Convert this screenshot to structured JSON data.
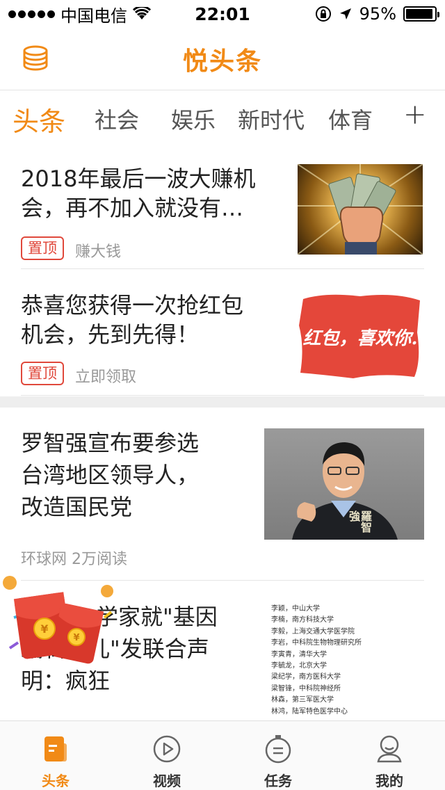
{
  "status_bar": {
    "carrier": "中国电信",
    "time": "22:01",
    "battery_percent": "95%",
    "battery_level": 0.95
  },
  "header": {
    "title": "悦头条"
  },
  "tabs": {
    "items": [
      "头条",
      "社会",
      "娱乐",
      "新时代",
      "体育"
    ],
    "active": "头条",
    "add": "+"
  },
  "feed": {
    "articles": [
      {
        "title_line1": "2018年最后一波大赚机",
        "title_line2": "会，再不加入就没有…",
        "badge": "置顶",
        "source": "赚大钱"
      },
      {
        "title_line1": "恭喜您获得一次抢红包",
        "title_line2": "机会，先到先得！",
        "badge": "置顶",
        "source": "立即领取",
        "image_text": "红包，喜欢你."
      },
      {
        "title_line1": "罗智强宣布要参选",
        "title_line2": "台湾地区领导人，",
        "title_line3": "改造国民党",
        "source": "环球网 2万阅读",
        "image_text": "羅智強"
      },
      {
        "title_line1": "学家就\"基因",
        "title_line2": "编辑婴儿\"发联合声",
        "title_line3": "明：疯狂",
        "image_lines": [
          "李颖，中山大学",
          "李楠，南方科技大学",
          "李毅，上海交通大学医学院",
          "李岩，中科院生物物理研究所",
          "李寅青，清华大学",
          "李毓龙，北京大学",
          "梁纪学，南方医科大学",
          "梁智锋，中科院神经所",
          "林森，第三军医大学",
          "林鸿，陆军特色医学中心"
        ]
      }
    ]
  },
  "tab_bar": {
    "items": [
      {
        "label": "头条",
        "icon": "headline-icon",
        "active": true
      },
      {
        "label": "视频",
        "icon": "play-circle-icon",
        "active": false
      },
      {
        "label": "任务",
        "icon": "task-timer-icon",
        "active": false
      },
      {
        "label": "我的",
        "icon": "profile-icon",
        "active": false
      }
    ]
  },
  "colors": {
    "accent": "#f18a16",
    "badge_red": "#e0483b"
  }
}
